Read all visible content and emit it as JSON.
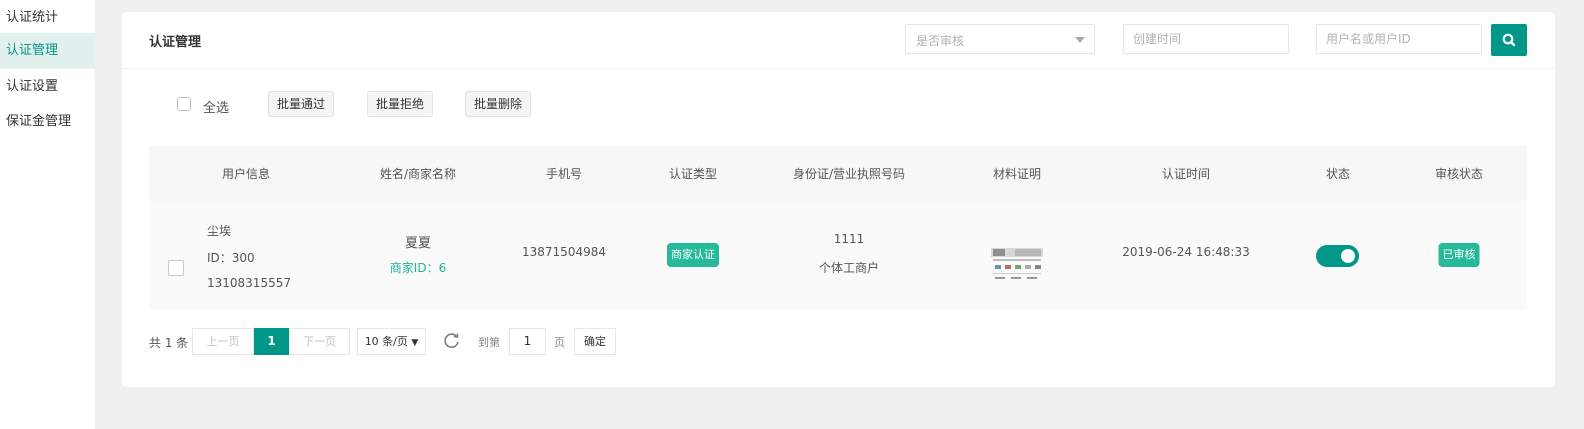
{
  "sidebar": {
    "items": [
      {
        "label": "认证统计"
      },
      {
        "label": "认证管理"
      },
      {
        "label": "认证设置"
      },
      {
        "label": "保证金管理"
      }
    ]
  },
  "header": {
    "title": "认证管理",
    "filter_placeholder": "是否审核",
    "date_placeholder": "创建时间",
    "search_placeholder": "用户名或用户ID"
  },
  "toolbar": {
    "select_all": "全选",
    "approve": "批量通过",
    "reject": "批量拒绝",
    "delete": "批量删除"
  },
  "table": {
    "columns": [
      "用户信息",
      "姓名/商家名称",
      "手机号",
      "认证类型",
      "身份证/营业执照号码",
      "材料证明",
      "认证时间",
      "状态",
      "审核状态"
    ],
    "rows": [
      {
        "username": "尘埃",
        "user_id": "ID：300",
        "user_phone": "13108315557",
        "name": "夏夏",
        "merchant_id": "商家ID：6",
        "phone": "13871504984",
        "cert_type": "商家认证",
        "id_number": "1111",
        "biz_type": "个体工商户",
        "cert_time": "2019-06-24 16:48:33",
        "audit_status": "已审核"
      }
    ]
  },
  "pagination": {
    "total": "共 1 条",
    "prev": "上一页",
    "current": "1",
    "next": "下一页",
    "page_size": "10 条/页",
    "goto_label": "到第",
    "goto_value": "1",
    "page_unit": "页",
    "confirm": "确定"
  },
  "colors": {
    "accent": "#009688",
    "badge": "#26b99a"
  }
}
